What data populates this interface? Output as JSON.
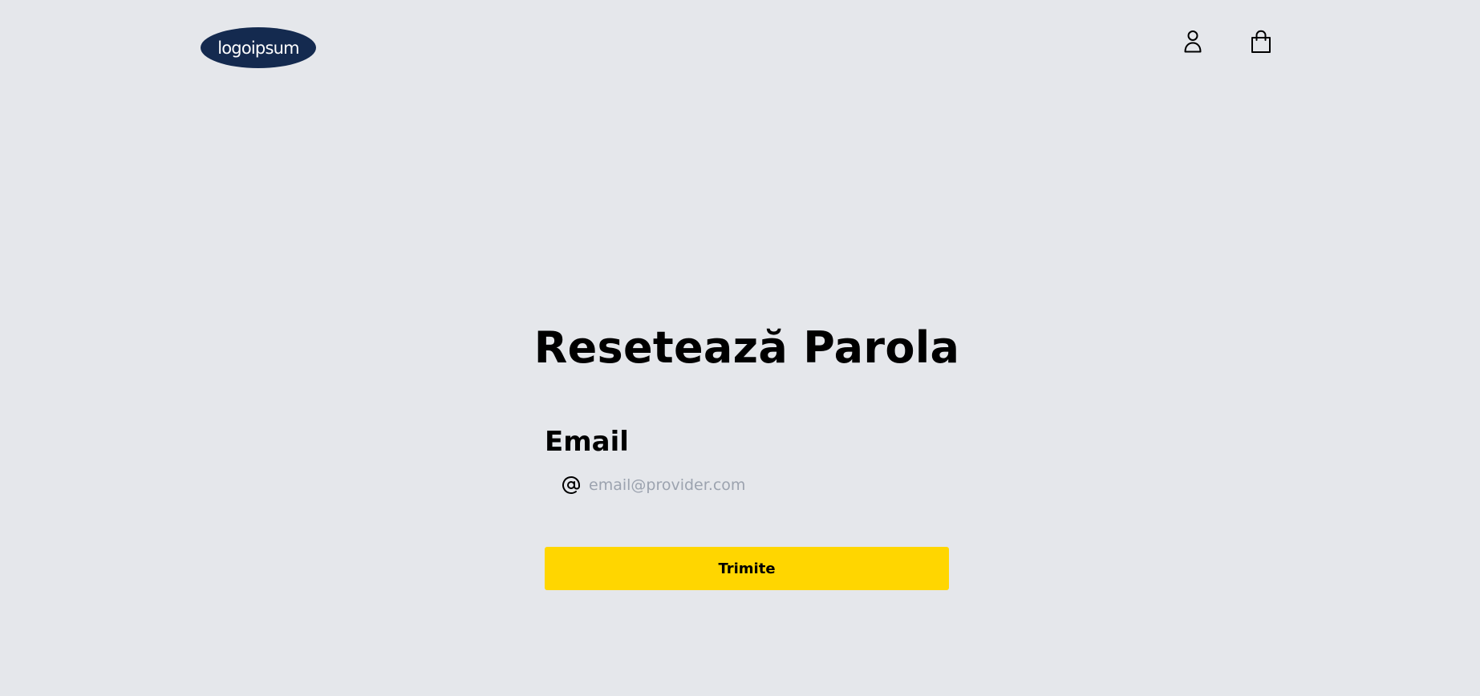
{
  "header": {
    "logo_text": "logoipsum",
    "logo_color": "#142a4f",
    "icons": [
      "user-icon",
      "shopping-bag-icon"
    ]
  },
  "main": {
    "title": "Resetează Parola",
    "email_label": "Email",
    "email_placeholder": "email@provider.com",
    "email_value": "",
    "email_icon": "at-sign-icon",
    "submit_label": "Trimite"
  },
  "colors": {
    "background": "#e5e7eb",
    "button": "#ffd600",
    "placeholder": "#9ca3af"
  }
}
